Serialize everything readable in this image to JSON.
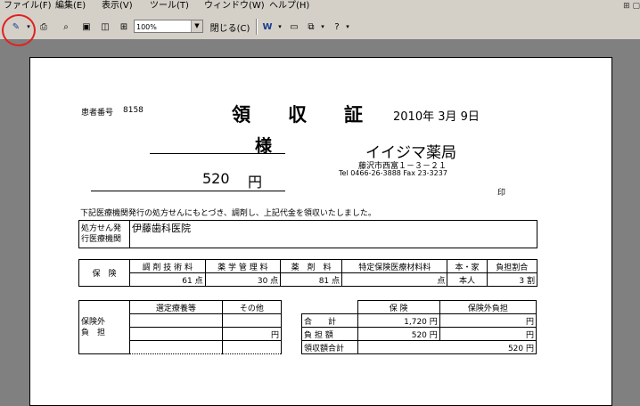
{
  "menu": [
    "ファイル(F)",
    "編集(E)",
    "表示(V)",
    "ツール(T)",
    "ウィンドウ(W)",
    "ヘルプ(H)"
  ],
  "toolbar": {
    "zoom": "100%",
    "close": "閉じる(C)"
  },
  "receipt": {
    "patient_label": "患者番号",
    "patient_no": "8158",
    "title": "領　　収　　証",
    "date": "2010年 3月 9日",
    "sama": "様",
    "amount": "520",
    "yen": "円",
    "pharmacy": "イイジマ薬局",
    "address": "藤沢市西富１－３－２１",
    "tel": "Tel 0466-26-3888 Fax 23-3237",
    "seal": "印",
    "statement": "下記医療機関発行の処方せんにもとづき、調剤し、上記代金を領収いたしました。",
    "clinic_label1": "処方せん発",
    "clinic_label2": "行医療機関",
    "clinic_name": "伊藤歯科医院"
  },
  "insurance": {
    "label": "保　険",
    "headers": [
      "調 剤 技 術 料",
      "薬 学 管 理 料",
      "薬　剤　料",
      "特定保険医療材料料",
      "本・家",
      "負担割合"
    ],
    "values": [
      "61 点",
      "30 点",
      "81 点",
      "点",
      "本人",
      "3 割"
    ]
  },
  "outside": {
    "label1": "保険外",
    "label2": "負　担",
    "col1": "選定療養等",
    "col2": "その他",
    "yen": "円"
  },
  "summary": {
    "headers": [
      "保 険",
      "保険外負担"
    ],
    "rows": [
      {
        "label": "合　　計",
        "ins": "1,720 円",
        "out": "円"
      },
      {
        "label": "負 担 額",
        "ins": "520 円",
        "out": "円"
      }
    ],
    "total_label": "領収額合計",
    "total": "520 円"
  }
}
